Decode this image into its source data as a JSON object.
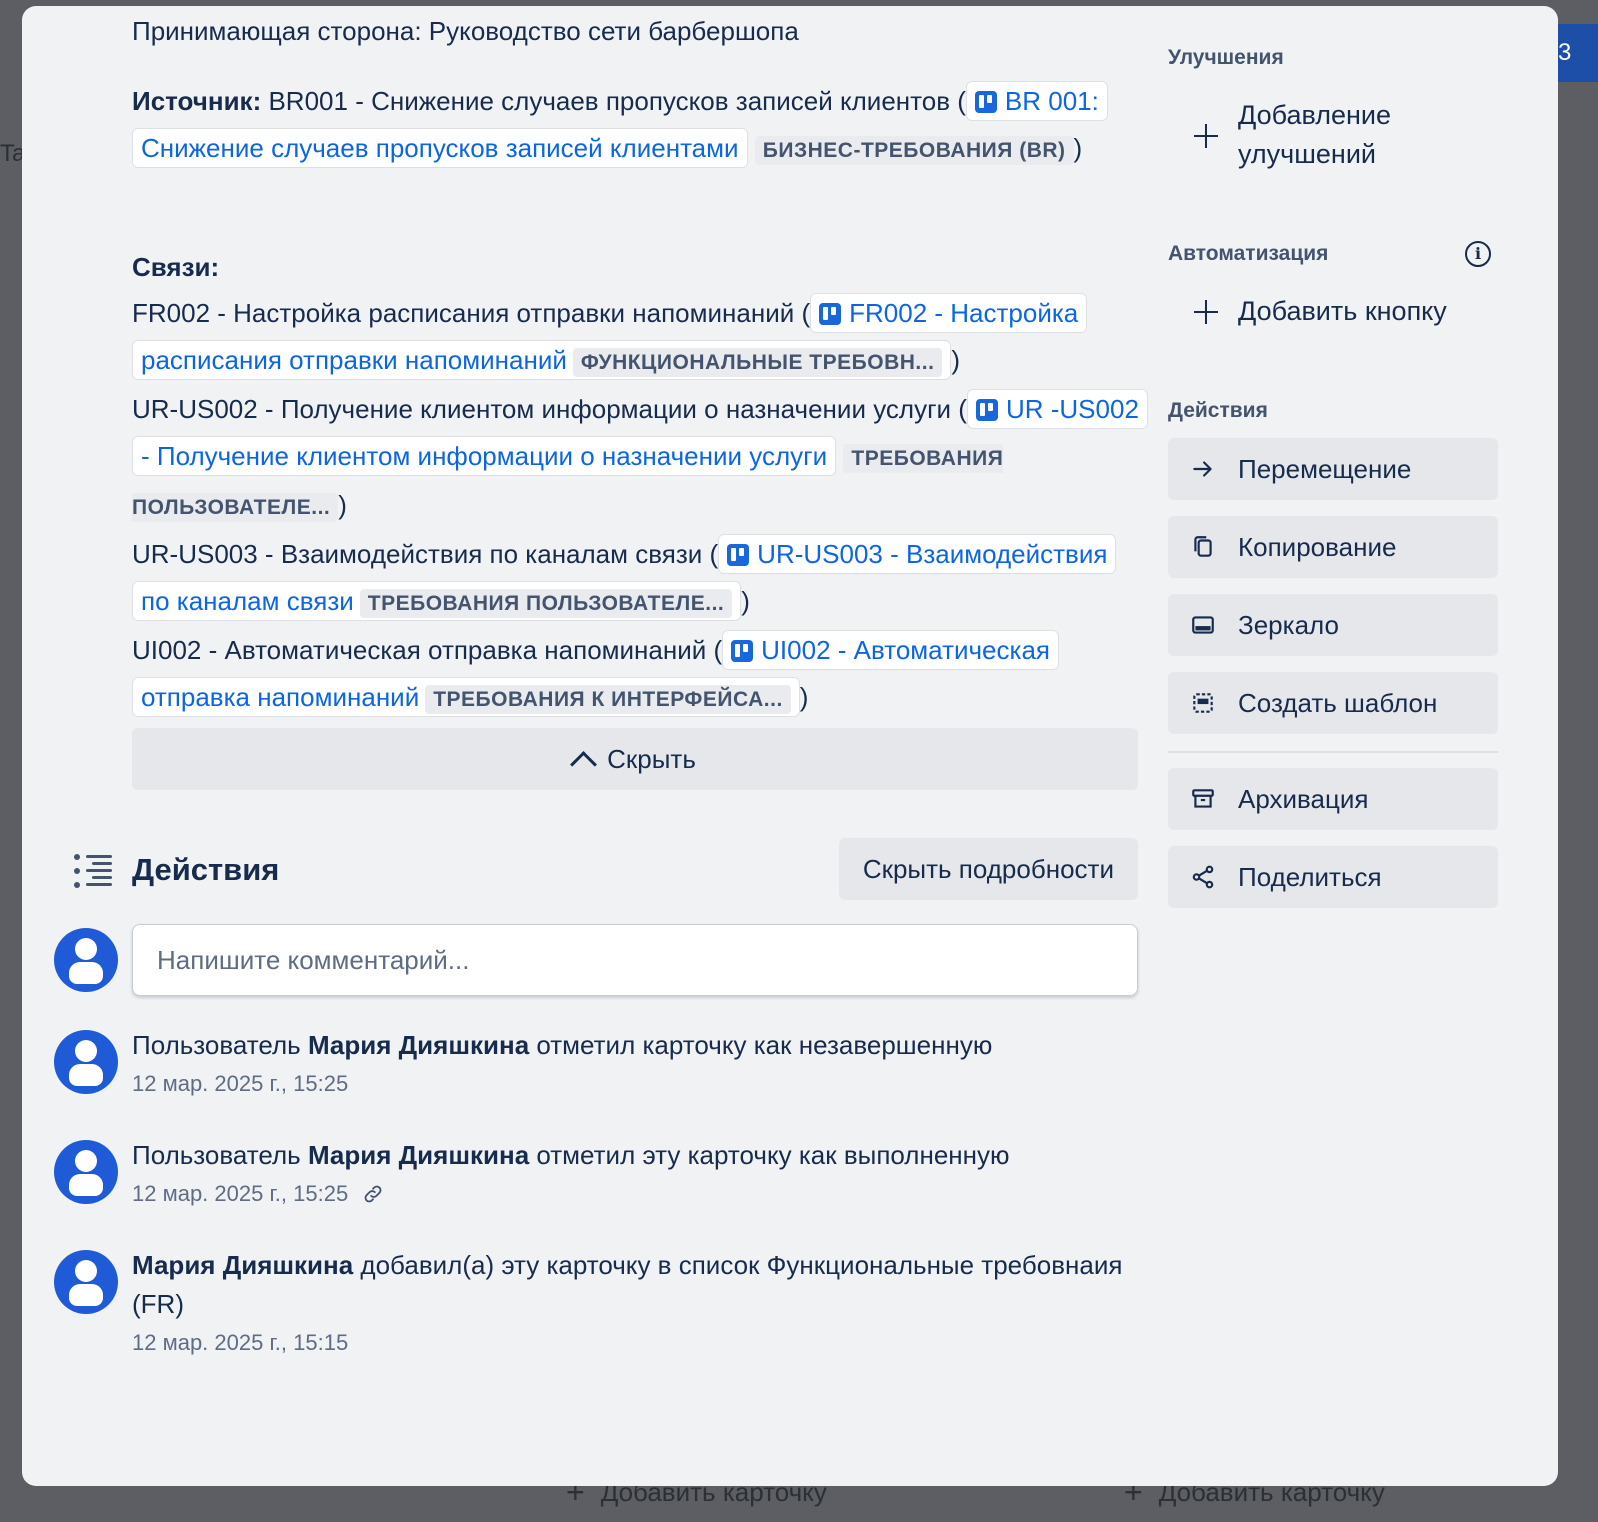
{
  "background": {
    "badge": "3",
    "left_letter": "Ta",
    "add_card_1": "Добавить карточку",
    "add_card_2": "Добавить карточку"
  },
  "card": {
    "receiver": "Принимающая сторона: Руководство сети барбершопа",
    "source": {
      "label": "Источник:",
      "text": "BR001 - Снижение случаев пропусков записей клиентов (",
      "link": "BR 001: Снижение случаев пропусков записей клиентами",
      "tag": "БИЗНЕС-ТРЕБОВАНИЯ (BR)",
      "close": ")"
    },
    "links_label": "Связи:",
    "links": [
      {
        "text": "FR002 - Настройка расписания отправки напоминаний (",
        "link": "FR002 - Настройка расписания отправки напоминаний",
        "tag": "ФУНКЦИОНАЛЬНЫЕ ТРЕБОВН...",
        "close": ")"
      },
      {
        "text": "UR-US002 - Получение клиентом информации о назначении услуги (",
        "link": "UR -US002 - Получение клиентом информации о назначении услуги",
        "tag": "ТРЕБОВАНИЯ ПОЛЬЗОВАТЕЛЕ...",
        "close": ")"
      },
      {
        "text": "UR-US003 - Взаимодействия по каналам связи (",
        "link": "UR-US003 - Взаимодействия по каналам связи",
        "tag": "ТРЕБОВАНИЯ ПОЛЬЗОВАТЕЛЕ...",
        "close": ")"
      },
      {
        "text": "UI002 - Автоматическая отправка напоминаний (",
        "link": "UI002 - Автоматическая отправка напоминаний",
        "tag": "ТРЕБОВАНИЯ К ИНТЕРФЕЙСА...",
        "close": ")"
      }
    ],
    "hide_label": "Скрыть"
  },
  "activity": {
    "title": "Действия",
    "details_button": "Скрыть подробности",
    "comment_placeholder": "Напишите комментарий...",
    "items": [
      {
        "prefix": "Пользователь ",
        "user": "Мария Дияшкина",
        "text": " отметил карточку как незавершенную",
        "time": "12 мар. 2025 г., 15:25"
      },
      {
        "prefix": "Пользователь ",
        "user": "Мария Дияшкина",
        "text": " отметил эту карточку как выполненную",
        "time": "12 мар. 2025 г., 15:25"
      },
      {
        "prefix": "",
        "user": "Мария Дияшкина",
        "text": " добавил(а) эту карточку в список Функциональные требовнаия (FR)",
        "time": "12 мар. 2025 г., 15:15"
      }
    ]
  },
  "sidebar": {
    "improvements_label": "Улучшения",
    "add_improvements": "Добавление улучшений",
    "automation_label": "Автоматизация",
    "add_button": "Добавить кнопку",
    "actions_label": "Действия",
    "actions": [
      {
        "label": "Перемещение",
        "icon": "arrow-right-icon"
      },
      {
        "label": "Копирование",
        "icon": "copy-icon"
      },
      {
        "label": "Зеркало",
        "icon": "mirror-icon"
      },
      {
        "label": "Создать шаблон",
        "icon": "template-icon"
      },
      {
        "label": "Архивация",
        "icon": "archive-icon"
      },
      {
        "label": "Поделиться",
        "icon": "share-icon"
      }
    ]
  }
}
